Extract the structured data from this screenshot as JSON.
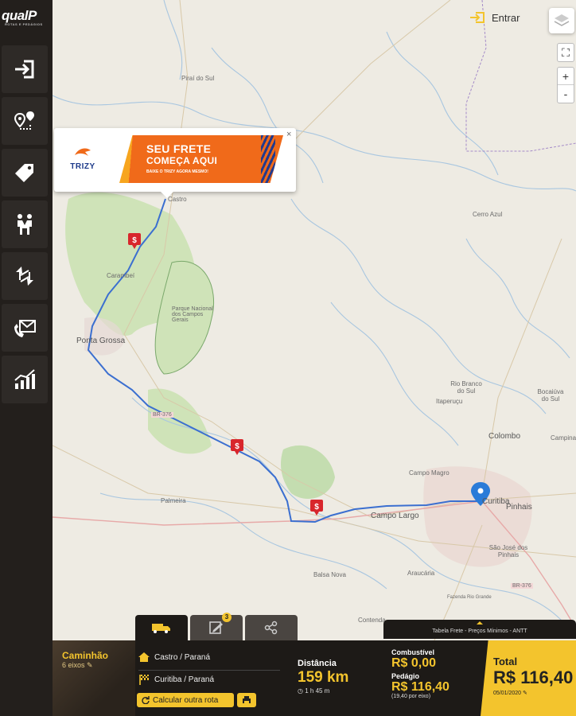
{
  "app": {
    "logo": "qualP",
    "logo_sub": "ROTAS E PEDÁGIOS"
  },
  "sidebar": {
    "items": [
      {
        "name": "login",
        "icon": "sign-in-icon"
      },
      {
        "name": "route",
        "icon": "route-pin-icon"
      },
      {
        "name": "tags",
        "icon": "tag-icon"
      },
      {
        "name": "partners",
        "icon": "handshake-icon"
      },
      {
        "name": "exchange",
        "icon": "exchange-icon"
      },
      {
        "name": "contact",
        "icon": "contact-icon"
      },
      {
        "name": "stats",
        "icon": "chart-icon"
      }
    ]
  },
  "header": {
    "login_label": "Entrar"
  },
  "map_controls": {
    "fullscreen": "⛶",
    "zoom_in": "+",
    "zoom_out": "-"
  },
  "ad": {
    "brand": "TRIZY",
    "headline1": "SEU FRETE",
    "headline2": "COMEÇA AQUI",
    "tagline": "BAIXE O TRIZY AGORA MESMO!",
    "close": "×"
  },
  "map_labels": [
    "Piraí do Sul",
    "Castro",
    "Carambeí",
    "Parque Nacional dos Campos Gerais",
    "Ponta Grossa",
    "Palmeira",
    "Campo Largo",
    "Balsa Nova",
    "Araucária",
    "Campo Magro",
    "Colombo",
    "Curitiba",
    "Pinhais",
    "São José dos Pinhais",
    "Cerro Azul",
    "Rio Branco do Sul",
    "Itaperuçu",
    "Bocaiúva do Sul",
    "Contenda",
    "Fazenda Rio Grande",
    "BR-376",
    "BR-376",
    "Campina Grande"
  ],
  "bottom": {
    "tabs": [
      {
        "name": "truck",
        "icon": "truck-icon"
      },
      {
        "name": "edit",
        "icon": "edit-list-icon",
        "badge": "3"
      },
      {
        "name": "share",
        "icon": "share-icon"
      }
    ],
    "vehicle": {
      "name": "Caminhão",
      "axles": "6 eixos"
    },
    "origin": "Castro / Paraná",
    "destination": "Curitiba / Paraná",
    "calc_button": "Calcular outra rota",
    "distance": {
      "label": "Distância",
      "value": "159 km",
      "time": "1 h 45 m"
    },
    "tabela": "Tabela Frete - Preços Mínimos - ANTT",
    "fuel": {
      "label": "Combustível",
      "value": "R$ 0,00"
    },
    "toll": {
      "label": "Pedágio",
      "value": "R$ 116,40",
      "per_axle": "(19,40 por eixo)"
    },
    "total": {
      "label": "Total",
      "value": "R$ 116,40",
      "date": "05/01/2020"
    }
  },
  "colors": {
    "accent": "#f3c42d",
    "sidebar": "#231f1c",
    "route": "#3b6fd0",
    "marker": "#d8262c"
  }
}
